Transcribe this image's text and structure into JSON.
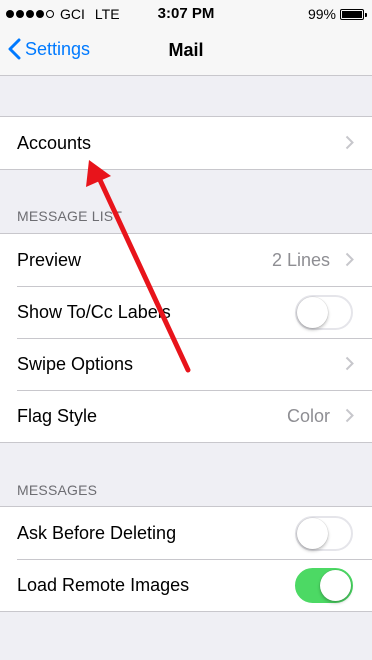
{
  "status_bar": {
    "carrier": "GCI",
    "network": "LTE",
    "time": "3:07 PM",
    "battery": "99%",
    "battery_level": 0.99,
    "signal_bars": 4
  },
  "nav": {
    "back_label": "Settings",
    "title": "Mail"
  },
  "accounts": {
    "label": "Accounts"
  },
  "message_list": {
    "header": "MESSAGE LIST",
    "preview": {
      "label": "Preview",
      "value": "2 Lines"
    },
    "show_to_cc": {
      "label": "Show To/Cc Labels",
      "on": false
    },
    "swipe_options": {
      "label": "Swipe Options"
    },
    "flag_style": {
      "label": "Flag Style",
      "value": "Color"
    }
  },
  "messages": {
    "header": "MESSAGES",
    "ask_before_deleting": {
      "label": "Ask Before Deleting",
      "on": false
    },
    "load_remote_images": {
      "label": "Load Remote Images",
      "on": true
    }
  },
  "colors": {
    "accent": "#007aff",
    "toggle_on": "#4cd964",
    "annotation_arrow": "#e8141b"
  }
}
